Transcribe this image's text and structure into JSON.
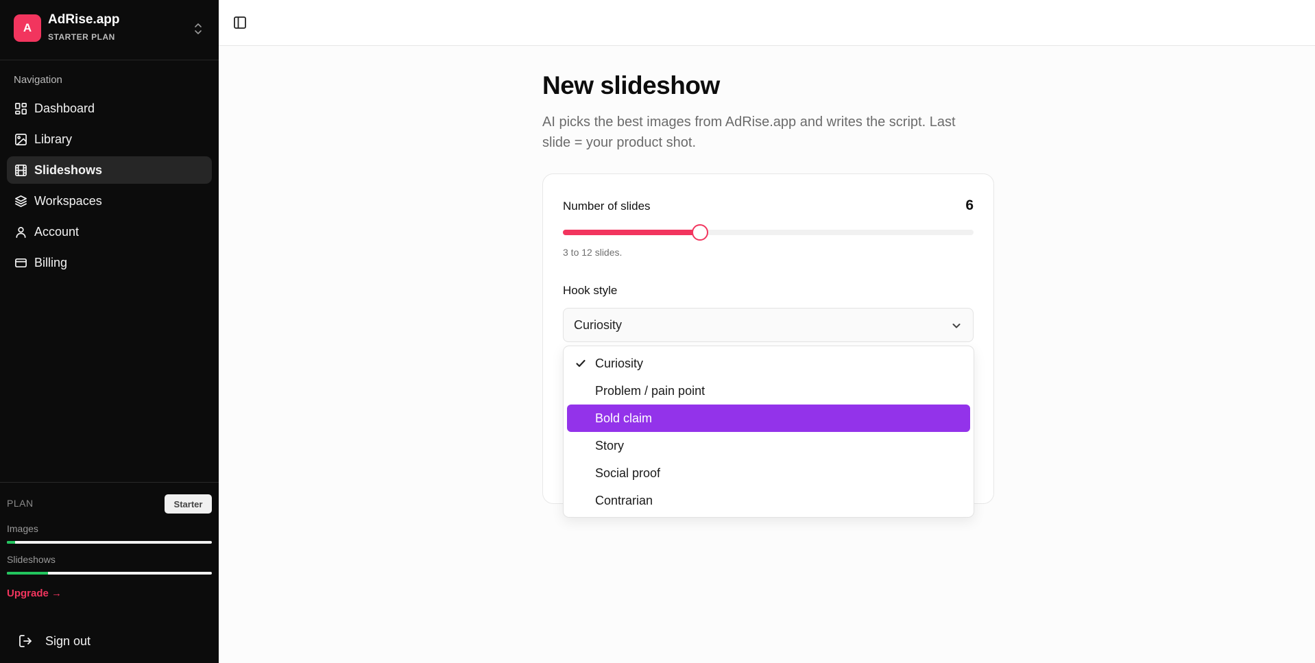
{
  "sidebar": {
    "brand": {
      "initial": "A",
      "name": "AdRise.app",
      "plan": "STARTER PLAN"
    },
    "nav_heading": "Navigation",
    "items": [
      {
        "label": "Dashboard",
        "icon": "dashboard-icon"
      },
      {
        "label": "Library",
        "icon": "image-icon"
      },
      {
        "label": "Slideshows",
        "icon": "film-icon",
        "active": true
      },
      {
        "label": "Workspaces",
        "icon": "layers-icon"
      },
      {
        "label": "Account",
        "icon": "user-icon"
      },
      {
        "label": "Billing",
        "icon": "credit-card-icon"
      }
    ],
    "plan": {
      "label": "PLAN",
      "badge": "Starter",
      "usage": [
        {
          "label": "Images",
          "fraction": 0.04
        },
        {
          "label": "Slideshows",
          "fraction": 0.2
        }
      ],
      "upgrade": "Upgrade →"
    },
    "signout": "Sign out"
  },
  "main": {
    "title": "New slideshow",
    "subtitle": "AI picks the best images from AdRise.app and writes the script. Last slide = your product shot.",
    "slides": {
      "label": "Number of slides",
      "value": 6,
      "min": 3,
      "max": 12,
      "hint": "3 to 12 slides."
    },
    "hook": {
      "label": "Hook style",
      "selected": "Curiosity",
      "options": [
        "Curiosity",
        "Problem / pain point",
        "Bold claim",
        "Story",
        "Social proof",
        "Contrarian"
      ],
      "highlighted": "Bold claim"
    }
  },
  "colors": {
    "accent": "#f2355e",
    "highlight": "#9333ea",
    "usage": "#22c55e",
    "sidebar_bg": "#0c0c0c"
  }
}
